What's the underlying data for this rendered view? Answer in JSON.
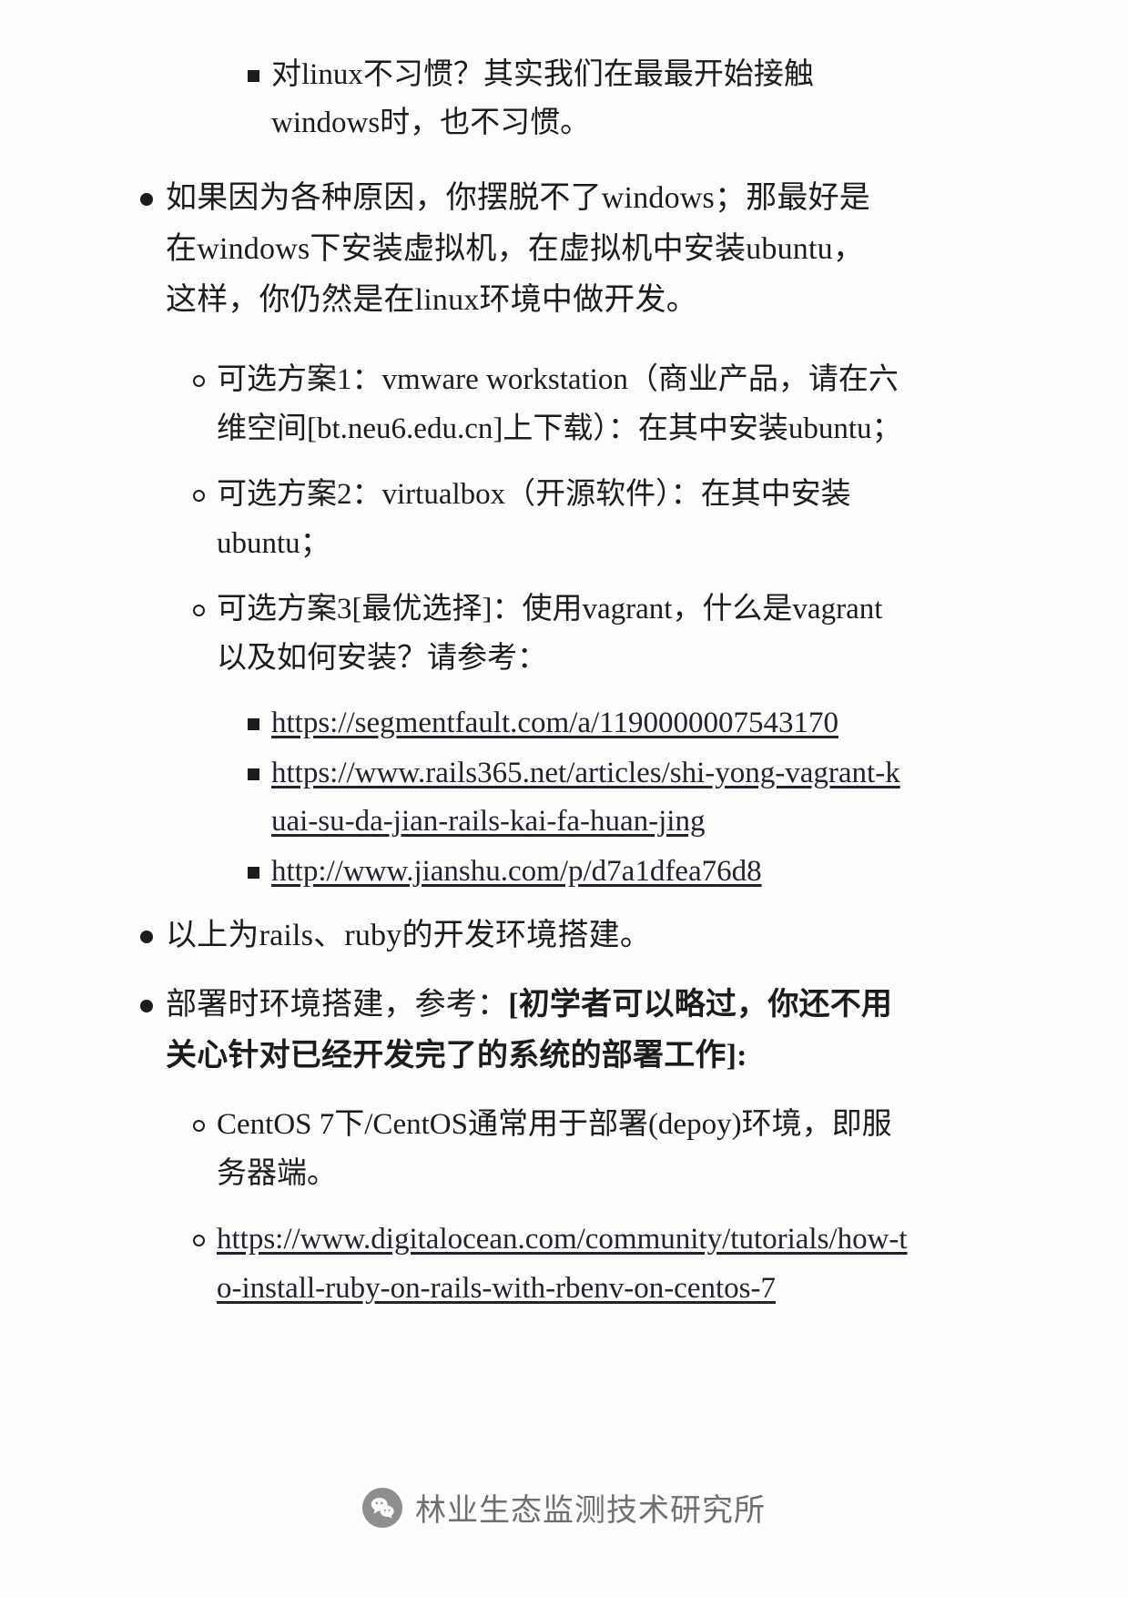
{
  "document": {
    "blocks": [
      {
        "level": 3,
        "bullet": "square",
        "text": "对linux不习惯？其实我们在最最开始接触windows时，也不习惯。"
      },
      {
        "level": 1,
        "bullet": "disc",
        "text": "如果因为各种原因，你摆脱不了windows；那最好是在windows下安装虚拟机，在虚拟机中安装ubuntu，这样，你仍然是在linux环境中做开发。"
      },
      {
        "level": 2,
        "bullet": "circle",
        "text": "可选方案1：vmware workstation（商业产品，请在六维空间[bt.neu6.edu.cn]上下载）：在其中安装ubuntu；"
      },
      {
        "level": 2,
        "bullet": "circle",
        "text": "可选方案2：virtualbox（开源软件）：在其中安装ubuntu；"
      },
      {
        "level": 2,
        "bullet": "circle",
        "text": "可选方案3[最优选择]：使用vagrant，什么是vagrant以及如何安装？请参考："
      },
      {
        "level": 3,
        "bullet": "square",
        "link": "https://segmentfault.com/a/1190000007543170"
      },
      {
        "level": 3,
        "bullet": "square",
        "link": "https://www.rails365.net/articles/shi-yong-vagrant-kuai-su-da-jian-rails-kai-fa-huan-jing"
      },
      {
        "level": 3,
        "bullet": "square",
        "link": "http://www.jianshu.com/p/d7a1dfea76d8"
      },
      {
        "level": 1,
        "bullet": "disc",
        "text": "以上为rails、ruby的开发环境搭建。"
      },
      {
        "level": 1,
        "bullet": "disc",
        "text_plain": "部署时环境搭建，参考：",
        "text_bold": "[初学者可以略过，你还不用关心针对已经开发完了的系统的部署工作]:"
      },
      {
        "level": 2,
        "bullet": "circle",
        "text": "CentOS 7下/CentOS通常用于部署(depoy)环境，即服务器端。"
      },
      {
        "level": 2,
        "bullet": "circle",
        "link": "https://www.digitalocean.com/community/tutorials/how-to-install-ruby-on-rails-with-rbenv-on-centos-7"
      }
    ]
  },
  "footer": {
    "icon": "wechat-icon",
    "label": "林业生态监测技术研究所"
  },
  "colors": {
    "text": "#1c1c1c",
    "link": "#232330",
    "footer_text": "#6f6f6f",
    "footer_badge": "#8e8e8e",
    "page_background": "#fdfdfc"
  }
}
